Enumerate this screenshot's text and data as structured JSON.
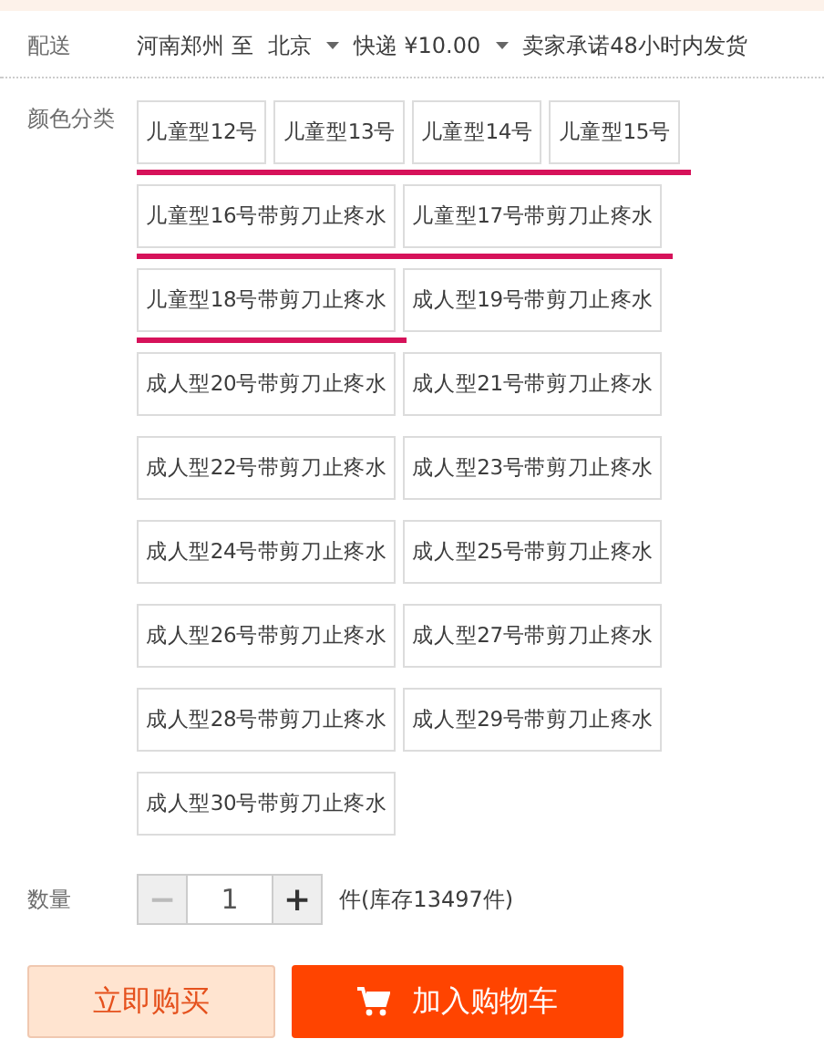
{
  "delivery": {
    "label": "配送",
    "from": "河南郑州 至",
    "to": "北京",
    "shipping": "快递 ¥10.00",
    "promise": "卖家承诺48小时内发货"
  },
  "color_options": {
    "label": "颜色分类",
    "options": [
      {
        "label": "儿童型12号",
        "underlined": true
      },
      {
        "label": "儿童型13号",
        "underlined": true
      },
      {
        "label": "儿童型14号",
        "underlined": true
      },
      {
        "label": "儿童型15号",
        "underlined": true
      },
      {
        "label": "儿童型16号带剪刀止疼水",
        "underlined": true
      },
      {
        "label": "儿童型17号带剪刀止疼水",
        "underlined": true
      },
      {
        "label": "儿童型18号带剪刀止疼水",
        "underlined": true
      },
      {
        "label": "成人型19号带剪刀止疼水",
        "underlined": false
      },
      {
        "label": "成人型20号带剪刀止疼水",
        "underlined": false
      },
      {
        "label": "成人型21号带剪刀止疼水",
        "underlined": false
      },
      {
        "label": "成人型22号带剪刀止疼水",
        "underlined": false
      },
      {
        "label": "成人型23号带剪刀止疼水",
        "underlined": false
      },
      {
        "label": "成人型24号带剪刀止疼水",
        "underlined": false
      },
      {
        "label": "成人型25号带剪刀止疼水",
        "underlined": false
      },
      {
        "label": "成人型26号带剪刀止疼水",
        "underlined": false
      },
      {
        "label": "成人型27号带剪刀止疼水",
        "underlined": false
      },
      {
        "label": "成人型28号带剪刀止疼水",
        "underlined": false
      },
      {
        "label": "成人型29号带剪刀止疼水",
        "underlined": false
      },
      {
        "label": "成人型30号带剪刀止疼水",
        "underlined": false
      }
    ]
  },
  "quantity": {
    "label": "数量",
    "decrement": "−",
    "value": "1",
    "increment": "+",
    "stock": "件(库存13497件)"
  },
  "buttons": [
    {
      "kind": "buy",
      "label": "立即购买"
    },
    {
      "kind": "cart",
      "label": "加入购物车"
    }
  ]
}
